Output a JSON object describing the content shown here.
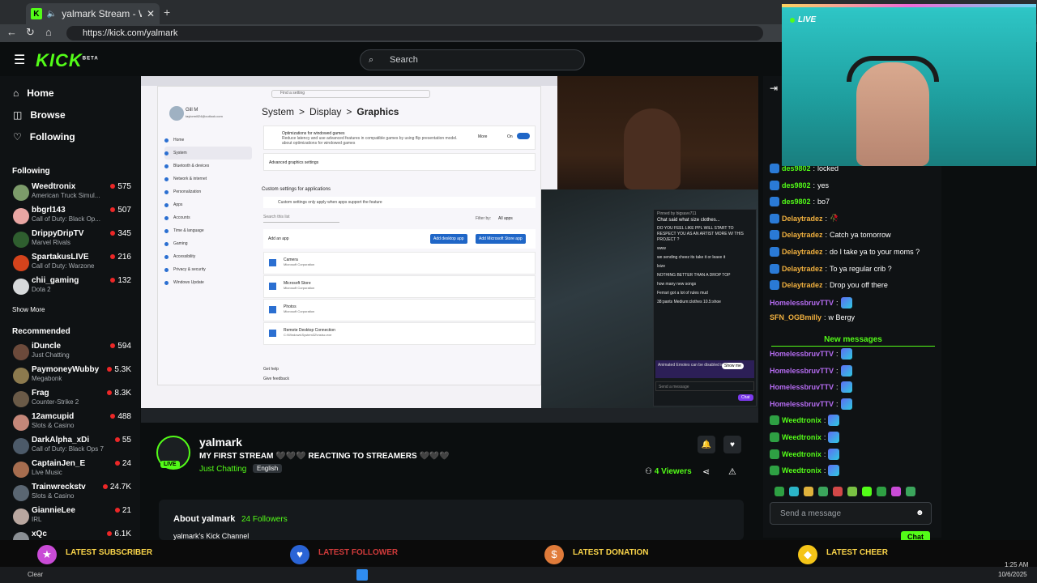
{
  "browser": {
    "tab_title": "yalmark Stream - Watch Live",
    "url": "https://kick.com/yalmark"
  },
  "header": {
    "logo": "KICK",
    "logo_badge": "BETA",
    "search_placeholder": "Search"
  },
  "sidebar": {
    "nav": [
      "Home",
      "Browse",
      "Following"
    ],
    "following_label": "Following",
    "following": [
      {
        "name": "Weedtronix",
        "category": "American Truck Simul...",
        "viewers": "575",
        "color": "#7c9b6a"
      },
      {
        "name": "bbgrl143",
        "category": "Call of Duty: Black Op...",
        "viewers": "507",
        "color": "#e9a6a3"
      },
      {
        "name": "DrippyDripTV",
        "category": "Marvel Rivals",
        "viewers": "345",
        "color": "#2f5e2f"
      },
      {
        "name": "SpartakusLIVE",
        "category": "Call of Duty: Warzone",
        "viewers": "216",
        "color": "#d4431c"
      },
      {
        "name": "chii_gaming",
        "category": "Dota 2",
        "viewers": "132",
        "color": "#d7d9db"
      }
    ],
    "show_more": "Show More",
    "recommended_label": "Recommended",
    "recommended": [
      {
        "name": "iDuncle",
        "category": "Just Chatting",
        "viewers": "594",
        "color": "#6c4a3b"
      },
      {
        "name": "PaymoneyWubby",
        "category": "Megabonk",
        "viewers": "5.3K",
        "color": "#8c7a4e"
      },
      {
        "name": "Frag",
        "category": "Counter-Strike 2",
        "viewers": "8.3K",
        "color": "#6a5a47"
      },
      {
        "name": "12amcupid",
        "category": "Slots & Casino",
        "viewers": "488",
        "color": "#c48779"
      },
      {
        "name": "DarkAlpha_xDi",
        "category": "Call of Duty: Black Ops 7",
        "viewers": "55",
        "color": "#4c5a69"
      },
      {
        "name": "CaptainJen_E",
        "category": "Live Music",
        "viewers": "24",
        "color": "#a66d4f"
      },
      {
        "name": "Trainwreckstv",
        "category": "Slots & Casino",
        "viewers": "24.7K",
        "color": "#5a6672"
      },
      {
        "name": "GiannieLee",
        "category": "IRL",
        "viewers": "21",
        "color": "#b9a7a0"
      },
      {
        "name": "xQc",
        "category": "",
        "viewers": "6.1K",
        "color": "#8a8f94"
      }
    ]
  },
  "video": {
    "settings": {
      "breadcrumb": [
        "System",
        ">",
        "Display",
        ">",
        "Graphics"
      ],
      "find_setting": "Find a setting",
      "user_name": "Gill M",
      "user_email": "taylormill24@outlook.com",
      "menu": [
        "Home",
        "System",
        "Bluetooth & devices",
        "Network & internet",
        "Personalization",
        "Apps",
        "Accounts",
        "Time & language",
        "Gaming",
        "Accessibility",
        "Privacy & security",
        "Windows Update"
      ],
      "opt_title": "Optimizations for windowed games",
      "opt_desc": "Reduce latency and use advanced features in compatible games by using flip presentation model.",
      "opt_more": "More",
      "opt_link": "about optimizations for windowed games",
      "opt_state": "On",
      "advanced": "Advanced graphics settings",
      "custom_title": "Custom settings for applications",
      "custom_note": "Custom settings only apply when apps support the feature",
      "search_list": "Search this list",
      "filter_label": "Filter by:",
      "filter_value": "All apps",
      "add_app": "Add an app",
      "btn_desktop": "Add desktop app",
      "btn_store": "Add Microsoft Store app",
      "apps": [
        {
          "name": "Camera",
          "pub": "Microsoft Corporation"
        },
        {
          "name": "Microsoft Store",
          "pub": "Microsoft Corporation"
        },
        {
          "name": "Photos",
          "pub": "Microsoft Corporation"
        },
        {
          "name": "Remote Desktop Connection",
          "pub": "C:\\Windows\\System32\\mstsc.exe"
        }
      ],
      "get_help": "Get help",
      "give_feedback": "Give feedback"
    },
    "mini_chat": {
      "pinned": "Pinned by bigsavv711",
      "pinned_text": "Chat said what size clothes...",
      "lines": [
        "DO YOU FEEL LIKE PPL WILL START TO RESPECT YOU AS AN ARTIST MORE W/ THIS PROJECT ?",
        "www",
        "we sending cheez its take it or leave it",
        "lsize",
        "NOTHING BETTER THAN A DROP TOP",
        "how many new songs",
        "Ferrari got a lot of rules mud",
        "38:pants Medium:clothes 10.5:shoe"
      ],
      "animated_note": "Animated Emotes can be disabled in Settings",
      "show_me": "Show me",
      "send": "Send a message",
      "chat_btn": "Chat"
    }
  },
  "stream": {
    "channel": "yalmark",
    "live": "LIVE",
    "title": "MY FIRST STREAM 🖤🖤🖤 REACTING TO STREAMERS 🖤🖤🖤",
    "category": "Just Chatting",
    "language": "English",
    "viewers": "4 Viewers",
    "about_label": "About yalmark",
    "followers": "24 Followers",
    "about_text": "yalmark's Kick Channel"
  },
  "chat": {
    "messages": [
      {
        "user": "des9802",
        "text": "locked",
        "color": "#53fc18",
        "badge": "#2a7ad6"
      },
      {
        "user": "des9802",
        "text": "yes",
        "color": "#53fc18",
        "badge": "#2a7ad6"
      },
      {
        "user": "des9802",
        "text": "bo7",
        "color": "#53fc18",
        "badge": "#2a7ad6"
      },
      {
        "user": "Delaytradez",
        "text": "🥀",
        "color": "#f2b13f",
        "badge": "#2a7ad6"
      },
      {
        "user": "Delaytradez",
        "text": "Catch ya tomorrow",
        "color": "#f2b13f",
        "badge": "#2a7ad6"
      },
      {
        "user": "Delaytradez",
        "text": "do I take ya to your moms ?",
        "color": "#f2b13f",
        "badge": "#2a7ad6"
      },
      {
        "user": "Delaytradez",
        "text": "To ya regular crib ?",
        "color": "#f2b13f",
        "badge": "#2a7ad6"
      },
      {
        "user": "Delaytradez",
        "text": "Drop you off there",
        "color": "#f2b13f",
        "badge": "#2a7ad6"
      },
      {
        "user": "HomelessbruvTTV",
        "text": "",
        "color": "#b66cf2",
        "badge": ""
      },
      {
        "user": "SFN_OGBmilly",
        "text": "w Bergy",
        "color": "#f2b13f",
        "badge": ""
      }
    ],
    "new_messages": "New messages",
    "new": [
      {
        "user": "HomelessbruvTTV",
        "color": "#b66cf2",
        "badge": ""
      },
      {
        "user": "HomelessbruvTTV",
        "color": "#b66cf2",
        "badge": ""
      },
      {
        "user": "HomelessbruvTTV",
        "color": "#b66cf2",
        "badge": ""
      },
      {
        "user": "HomelessbruvTTV",
        "color": "#b66cf2",
        "badge": ""
      },
      {
        "user": "Weedtronix",
        "color": "#53fc18",
        "badge": "#2ea043"
      },
      {
        "user": "Weedtronix",
        "color": "#53fc18",
        "badge": "#2ea043"
      },
      {
        "user": "Weedtronix",
        "color": "#53fc18",
        "badge": "#2ea043"
      },
      {
        "user": "Weedtronix",
        "color": "#53fc18",
        "badge": "#2ea043"
      }
    ],
    "send_placeholder": "Send a message",
    "chat_button": "Chat"
  },
  "overlay": {
    "live_label": "LIVE",
    "alerts": [
      {
        "label": "LATEST SUBSCRIBER",
        "icon": "star-icon",
        "color": "#c94bd6"
      },
      {
        "label": "LATEST FOLLOWER",
        "icon": "heart-icon",
        "color": "#2a64d6"
      },
      {
        "label": "LATEST DONATION",
        "icon": "dollar-icon",
        "color": "#e07b3a"
      },
      {
        "label": "LATEST CHEER",
        "icon": "diamond-icon",
        "color": "#f5c518"
      }
    ]
  },
  "taskbar": {
    "weather": "Clear",
    "time": "1:25 AM",
    "date": "10/6/2025"
  }
}
